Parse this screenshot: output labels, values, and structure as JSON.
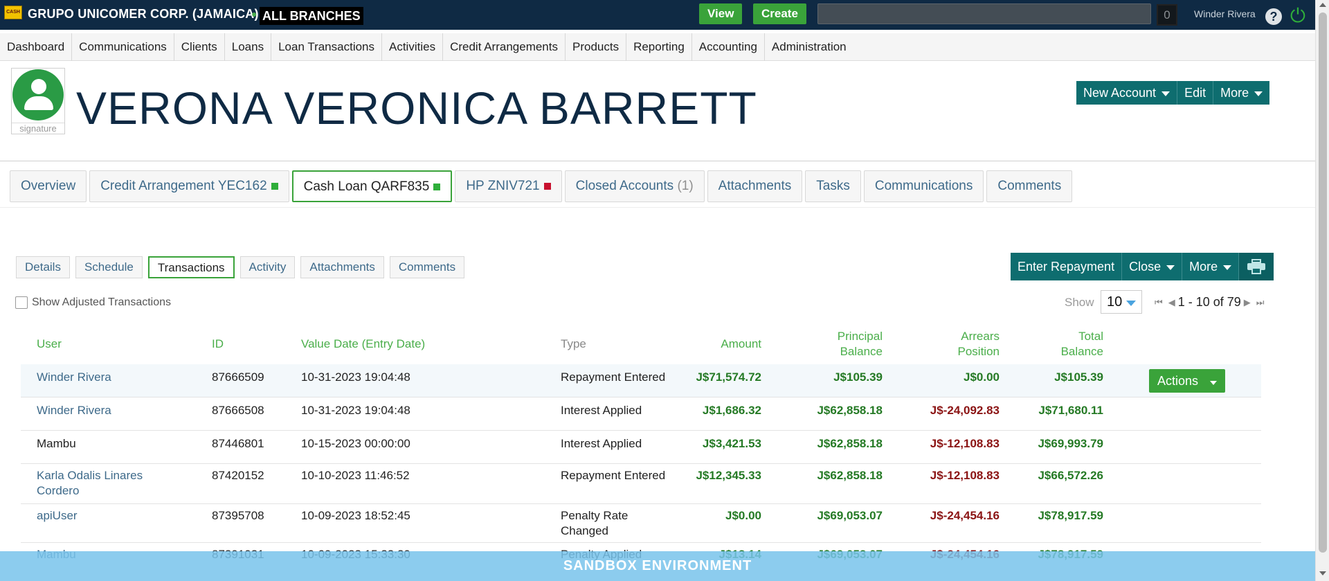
{
  "topbar": {
    "logo_text": "CASH",
    "org_name": "GRUPO UNICOMER CORP. (JAMAICA)",
    "status_dot": "●",
    "branch": "ALL BRANCHES",
    "view_label": "View",
    "create_label": "Create",
    "search_value": "",
    "counter": "0",
    "user": "Winder Rivera",
    "help_glyph": "?",
    "power_glyph": "⏻",
    "icons": [
      "help-icon",
      "power-icon"
    ],
    "colors": {
      "bar": "#0f2a44",
      "button": "#3aa33a"
    }
  },
  "nav": {
    "items": [
      "Dashboard",
      "Communications",
      "Clients",
      "Loans",
      "Loan Transactions",
      "Activities",
      "Credit Arrangements",
      "Products",
      "Reporting",
      "Accounting",
      "Administration"
    ]
  },
  "client": {
    "name": "VERONA VERONICA BARRETT",
    "signature_label": "signature",
    "actions": {
      "new_account": "New Account",
      "edit": "Edit",
      "more": "More"
    }
  },
  "account_tabs": [
    {
      "label": "Overview"
    },
    {
      "label": "Credit Arrangement YEC162",
      "status": "green"
    },
    {
      "label": "Cash Loan QARF835",
      "status": "green",
      "active": true
    },
    {
      "label": "HP ZNIV721",
      "status": "red"
    },
    {
      "label": "Closed Accounts",
      "count": "(1)"
    },
    {
      "label": "Attachments"
    },
    {
      "label": "Tasks"
    },
    {
      "label": "Communications"
    },
    {
      "label": "Comments"
    }
  ],
  "sub_tabs": [
    "Details",
    "Schedule",
    "Transactions",
    "Activity",
    "Attachments",
    "Comments"
  ],
  "loan_actions": {
    "enter_repayment": "Enter Repayment",
    "close": "Close",
    "more": "More",
    "print_icon": "printer-icon"
  },
  "filters": {
    "show_adjusted": "Show Adjusted Transactions",
    "show_label": "Show",
    "page_size": "10",
    "page_range": "1 - 10 of 79"
  },
  "table": {
    "columns": {
      "user": "User",
      "id": "ID",
      "value_date": "Value Date (Entry Date)",
      "type": "Type",
      "amount": "Amount",
      "principal_balance": [
        "Principal",
        "Balance"
      ],
      "arrears_position": [
        "Arrears",
        "Position"
      ],
      "total_balance": [
        "Total",
        "Balance"
      ]
    },
    "actions_label": "Actions",
    "rows": [
      {
        "user": "Winder Rivera",
        "user_link": true,
        "id": "87666509",
        "date": "10-31-2023 19:04:48",
        "type": "Repayment Entered",
        "amount": "J$71,574.72",
        "principal": "J$105.39",
        "arrears": "J$0.00",
        "arrears_negative": false,
        "total": "J$105.39",
        "has_actions": true
      },
      {
        "user": "Winder Rivera",
        "user_link": true,
        "id": "87666508",
        "date": "10-31-2023 19:04:48",
        "type": "Interest Applied",
        "amount": "J$1,686.32",
        "principal": "J$62,858.18",
        "arrears": "J$-24,092.83",
        "arrears_negative": true,
        "total": "J$71,680.11"
      },
      {
        "user": "Mambu",
        "user_link": false,
        "id": "87446801",
        "date": "10-15-2023 00:00:00",
        "type": "Interest Applied",
        "amount": "J$3,421.53",
        "principal": "J$62,858.18",
        "arrears": "J$-12,108.83",
        "arrears_negative": true,
        "total": "J$69,993.79"
      },
      {
        "user": "Karla Odalis Linares Cordero",
        "user_link": true,
        "id": "87420152",
        "date": "10-10-2023 11:46:52",
        "type": "Repayment Entered",
        "amount": "J$12,345.33",
        "principal": "J$62,858.18",
        "arrears": "J$-12,108.83",
        "arrears_negative": true,
        "total": "J$66,572.26"
      },
      {
        "user": "apiUser",
        "user_link": true,
        "id": "87395708",
        "date": "10-09-2023 18:52:45",
        "type": "Penalty Rate Changed",
        "amount": "J$0.00",
        "principal": "J$69,053.07",
        "arrears": "J$-24,454.16",
        "arrears_negative": true,
        "total": "J$78,917.59"
      },
      {
        "user": "Mambu",
        "user_link": true,
        "id": "87391031",
        "date": "10-09-2023 15:33:30",
        "type": "Penalty Applied",
        "amount": "J$13.14",
        "principal": "J$69,053.07",
        "arrears": "J$-24,454.16",
        "arrears_negative": true,
        "total": "J$78,917.59"
      }
    ]
  },
  "footer": {
    "banner": "SANDBOX ENVIRONMENT"
  }
}
